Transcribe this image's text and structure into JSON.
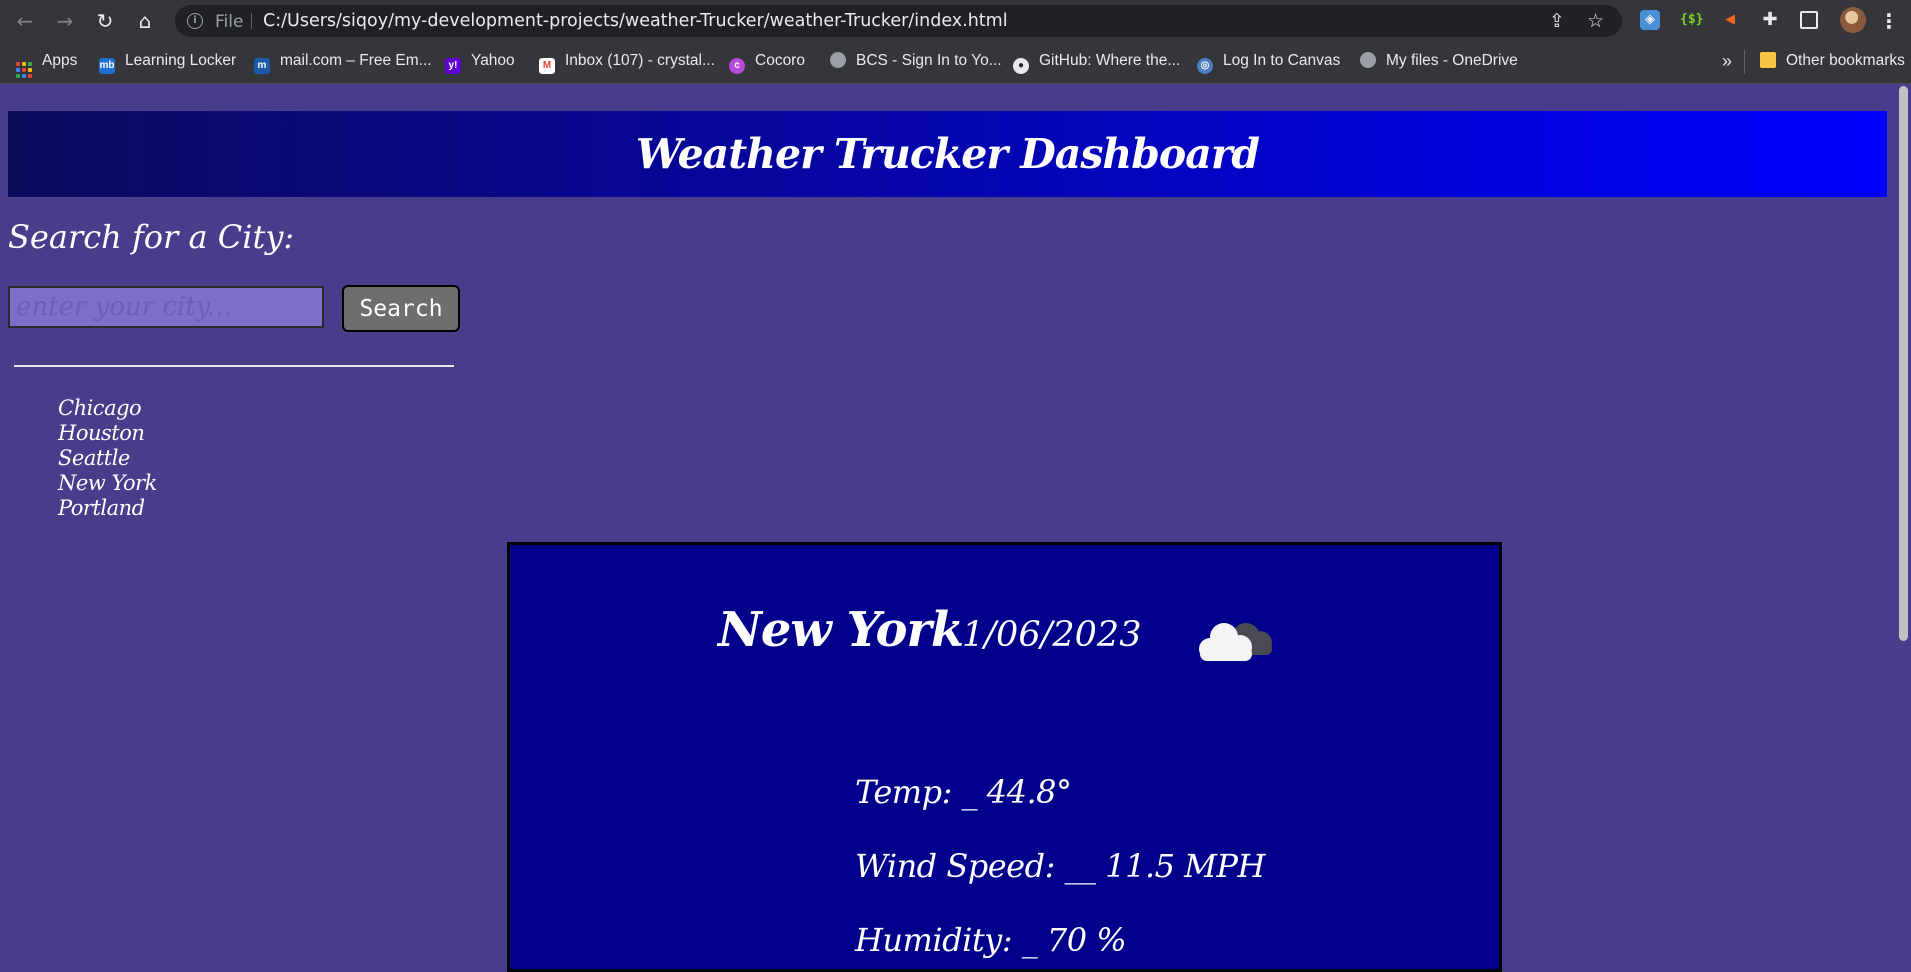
{
  "browser": {
    "address": {
      "scheme_label": "File",
      "url": "C:/Users/siqoy/my-development-projects/weather-Trucker/weather-Trucker/index.html"
    },
    "bookmarks": [
      {
        "label": "Apps",
        "icon": "apps-grid-icon"
      },
      {
        "label": "Learning Locker",
        "icon": "mb-icon",
        "glyph": "mb"
      },
      {
        "label": "mail.com – Free Em...",
        "icon": "mail-icon",
        "glyph": "m"
      },
      {
        "label": "Yahoo",
        "icon": "yahoo-icon",
        "glyph": "y!"
      },
      {
        "label": "Inbox (107) - crystal...",
        "icon": "gmail-icon",
        "glyph": "M"
      },
      {
        "label": "Cocoro",
        "icon": "cocoro-icon",
        "glyph": "c"
      },
      {
        "label": "BCS - Sign In to Yo...",
        "icon": "globe-icon",
        "glyph": "◍"
      },
      {
        "label": "GitHub: Where the...",
        "icon": "github-icon",
        "glyph": "●"
      },
      {
        "label": "Log In to Canvas",
        "icon": "canvas-icon",
        "glyph": "◎"
      },
      {
        "label": "My files - OneDrive",
        "icon": "globe-icon",
        "glyph": "◍"
      }
    ],
    "overflow_label": "»",
    "other_bookmarks_label": "Other bookmarks",
    "colors": {
      "chrome": "#35363a",
      "omnibox": "#202124"
    }
  },
  "page": {
    "title": "Weather Trucker Dashboard",
    "search": {
      "heading": "Search for a City:",
      "placeholder": "enter your city...",
      "button_label": "Search"
    },
    "history": [
      "Chicago",
      "Houston",
      "Seattle",
      "New York",
      "Portland"
    ],
    "current": {
      "city": "New York",
      "date": "1/06/2023",
      "icon": "cloudy-icon",
      "temp": "Temp: _ 44.8°",
      "wind": "Wind Speed: __ 11.5 MPH",
      "humidity": "Humidity: _ 70 %"
    },
    "colors": {
      "background": "#483d8b",
      "header_gradient_start": "#0a0a5c",
      "header_gradient_end": "#0000ff",
      "card": "#00008b"
    }
  }
}
